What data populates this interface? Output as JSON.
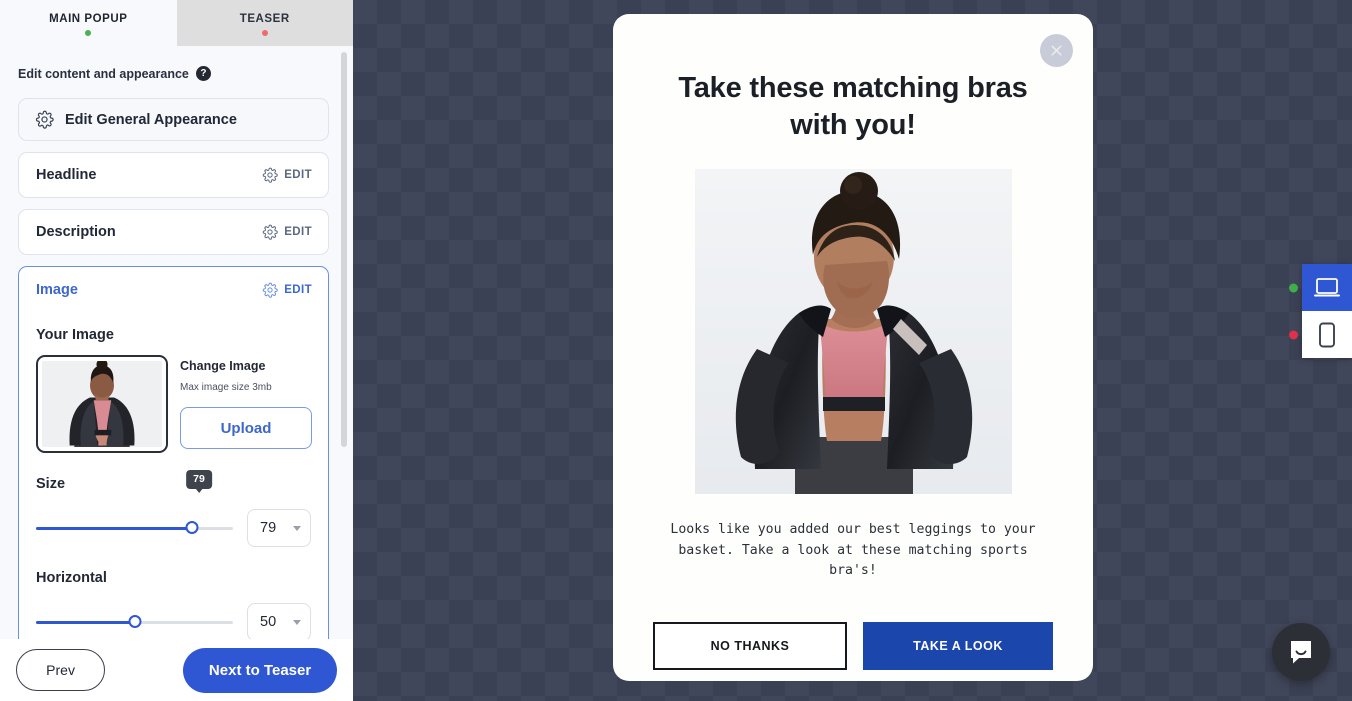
{
  "editor": {
    "tabs": [
      {
        "label": "MAIN POPUP",
        "status": "green",
        "active": true
      },
      {
        "label": "TEASER",
        "status": "red",
        "active": false
      }
    ],
    "section_title": "Edit content and appearance",
    "help_icon": "question-mark-icon",
    "general_appearance": {
      "label": "Edit General Appearance",
      "icon": "gear-icon"
    },
    "accordion": [
      {
        "label": "Headline",
        "edit_label": "EDIT",
        "icon": "gear-icon",
        "active": false
      },
      {
        "label": "Description",
        "edit_label": "EDIT",
        "icon": "gear-icon",
        "active": false
      },
      {
        "label": "Image",
        "edit_label": "EDIT",
        "icon": "gear-icon",
        "active": true
      }
    ],
    "image_panel": {
      "your_image_label": "Your Image",
      "change_image_label": "Change Image",
      "max_size_note": "Max image size 3mb",
      "upload_label": "Upload"
    },
    "controls": [
      {
        "label": "Size",
        "value": "79",
        "percent": 79,
        "bubble": "79",
        "show_bubble": true
      },
      {
        "label": "Horizontal",
        "value": "50",
        "percent": 50,
        "bubble": "50",
        "show_bubble": false
      }
    ],
    "footer": {
      "prev_label": "Prev",
      "next_label": "Next to Teaser"
    }
  },
  "preview": {
    "popup": {
      "close_icon": "close-icon",
      "headline": "Take these matching bras with you!",
      "image_alt": "woman-in-black-jacket-and-pink-sports-bra",
      "description": "Looks like you added our best leggings to your basket. Take a look at these matching sports bra's!",
      "buttons": [
        {
          "label": "NO THANKS",
          "style": "secondary"
        },
        {
          "label": "TAKE A LOOK",
          "style": "primary"
        }
      ]
    },
    "devices": [
      {
        "name": "desktop",
        "icon": "desktop-icon",
        "active": true,
        "status": "green"
      },
      {
        "name": "mobile",
        "icon": "mobile-icon",
        "active": false,
        "status": "red"
      }
    ],
    "chat_icon": "chat-bubble-icon"
  },
  "colors": {
    "accent_blue": "#2f56d3",
    "cta_blue": "#1b47ad",
    "status_green": "#4caf50",
    "status_red": "#ef6b6b",
    "stage_bg": "#41475a"
  }
}
